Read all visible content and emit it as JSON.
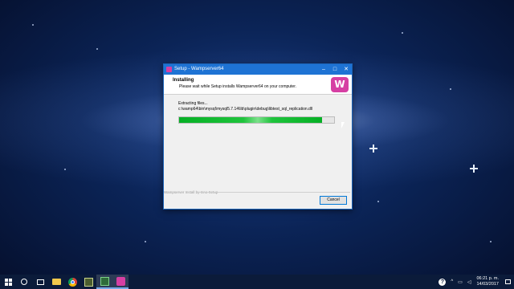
{
  "window": {
    "title": "Setup - Wampserver64",
    "controls": {
      "minimize": "–",
      "maximize": "□",
      "close": "✕"
    }
  },
  "header": {
    "title": "Installing",
    "subtitle": "Please wait while Setup installs Wampserver64 on your computer.",
    "logo_text": "W"
  },
  "progress": {
    "status": "Extracting files...",
    "file": "c:\\wamp64\\bin\\mysql\\mysql5.7.14\\lib\\plugin\\debug\\libtest_sql_replication.dll",
    "fraction": 0.92
  },
  "footer": {
    "brand": "Wampserver Install by Inno Setup",
    "cancel_label": "Cancel"
  },
  "taskbar": {
    "items": [
      {
        "name": "start",
        "icon": "windows-icon"
      },
      {
        "name": "search",
        "icon": "search-icon"
      },
      {
        "name": "task-view",
        "icon": "task-view-icon"
      },
      {
        "name": "file-explorer",
        "icon": "folder-icon"
      },
      {
        "name": "chrome",
        "icon": "chrome-icon"
      },
      {
        "name": "app",
        "icon": "app-icon"
      },
      {
        "name": "app-green",
        "icon": "app-icon"
      },
      {
        "name": "wampserver",
        "icon": "wamp-icon"
      }
    ],
    "tray": {
      "help": "?",
      "time": "06:21 p. m.",
      "date": "14/03/2017"
    }
  },
  "colors": {
    "accent": "#1e73d4",
    "progress": "#06b025",
    "wamp": "#d63fa3"
  }
}
